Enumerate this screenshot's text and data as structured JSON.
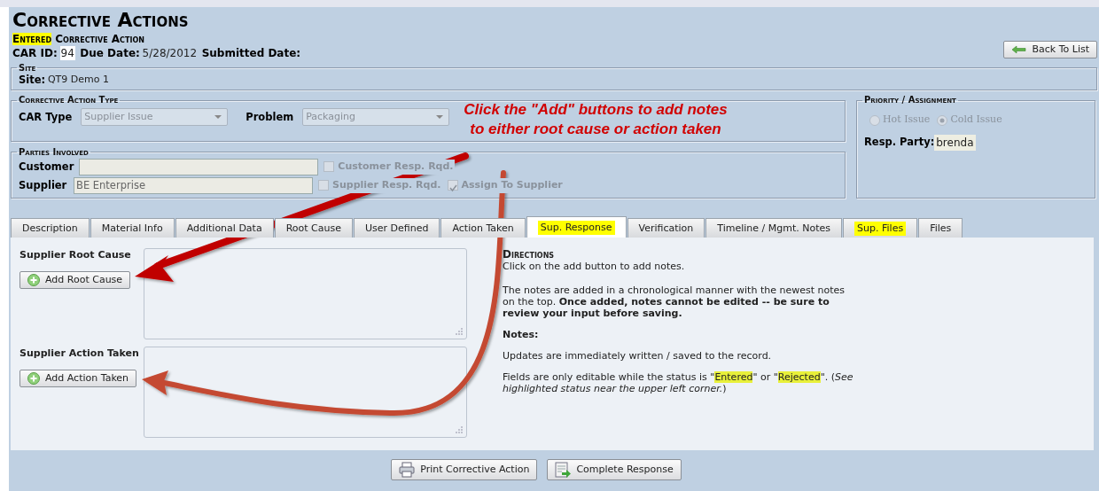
{
  "header": {
    "title": "Corrective Actions",
    "status": "Entered",
    "subtitle": "Corrective Action",
    "fields": [
      {
        "label": "CAR ID:",
        "value": "94",
        "boxed": true
      },
      {
        "label": "Due Date:",
        "value": "5/28/2012",
        "boxed": false
      },
      {
        "label": "Submitted Date:"
      }
    ]
  },
  "back_button": "Back To List",
  "site": {
    "legend": "Site",
    "label": "Site:",
    "value": "QT9 Demo 1"
  },
  "action_type": {
    "legend": "Corrective Action Type",
    "selects": [
      {
        "label": "CAR Type",
        "value": "Supplier Issue"
      },
      {
        "label": "Problem",
        "value": "Packaging"
      }
    ]
  },
  "priority": {
    "legend": "Priority / Assignment",
    "options": [
      {
        "label": "Hot Issue",
        "selected": false
      },
      {
        "label": "Cold Issue",
        "selected": true
      }
    ],
    "resp_label": "Resp. Party:",
    "resp_value": "brenda"
  },
  "parties": {
    "legend": "Parties Involved",
    "rows": [
      {
        "label": "Customer",
        "check": {
          "label": "Customer Resp. Rqd.",
          "checked": false
        }
      },
      {
        "label": "Supplier",
        "value": "BE Enterprise",
        "check": {
          "label": "Supplier Resp. Rqd.",
          "checked": false
        },
        "extra_check": {
          "label": "Assign To Supplier",
          "checked": true
        }
      }
    ]
  },
  "tabs": [
    {
      "label": "Description",
      "selected": false,
      "highlight": false
    },
    {
      "label": "Material Info",
      "selected": false,
      "highlight": false
    },
    {
      "label": "Additional Data",
      "selected": false,
      "highlight": false
    },
    {
      "label": "Root Cause",
      "selected": false,
      "highlight": false
    },
    {
      "label": "User Defined",
      "selected": false,
      "highlight": false
    },
    {
      "label": "Action Taken",
      "selected": false,
      "highlight": false
    },
    {
      "label": "Sup. Response",
      "selected": true,
      "highlight": true
    },
    {
      "label": "Verification",
      "selected": false,
      "highlight": false
    },
    {
      "label": "Timeline / Mgmt. Notes",
      "selected": false,
      "highlight": false
    },
    {
      "label": "Sup. Files",
      "selected": false,
      "highlight": true
    },
    {
      "label": "Files",
      "selected": false,
      "highlight": false
    }
  ],
  "sections": [
    {
      "label": "Supplier Root Cause",
      "button": "Add Root Cause"
    },
    {
      "label": "Supplier Action Taken",
      "button": "Add Action Taken"
    }
  ],
  "directions": {
    "title": "Directions",
    "paragraphs": [
      [
        {
          "text": "Click on the add button to add notes."
        }
      ],
      [
        {
          "text": "The notes are added in a chronological manner with the newest notes on the top. **Once added, notes cannot be edited -- be sure to review your input before saving.**"
        }
      ],
      [
        {
          "text": "**Notes:**"
        }
      ],
      [
        {
          "text": "Updates are immediately written / saved to the record."
        }
      ],
      [
        {
          "text": "Fields are only editable while the status is \""
        },
        {
          "text": "Entered",
          "highlight": true
        },
        {
          "text": "\" or \""
        },
        {
          "text": "Rejected",
          "highlight": true
        },
        {
          "text": "\". (*See highlighted status near the upper left corner.*)"
        }
      ]
    ]
  },
  "footer_buttons": [
    {
      "kind": "print",
      "label": "Print Corrective Action"
    },
    {
      "kind": "complete",
      "label": "Complete Response"
    }
  ],
  "annotation": {
    "text": "Click the \"Add\" buttons to add notes to either root cause or action taken"
  }
}
